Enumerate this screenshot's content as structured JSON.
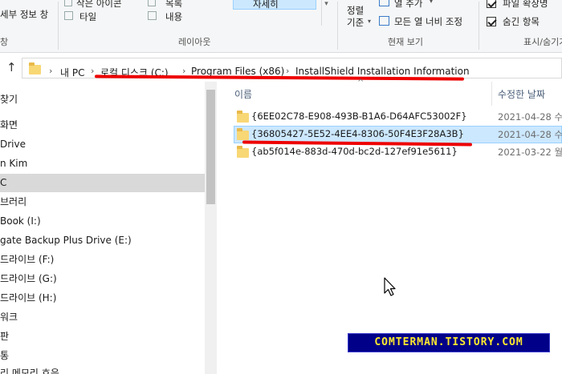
{
  "ribbon": {
    "layout_items": [
      "세부 정보 창",
      "작은 아이콘",
      "목록",
      "자세히",
      "타일",
      "내용"
    ],
    "layout_group": "레이아웃",
    "sort_label": "정렬\n기준",
    "add_column": "열 추가",
    "fit_columns": "모든 열 너비 조정",
    "current_view_group": "현재 보기",
    "file_ext": "파일 확장명",
    "hidden_items": "숨긴 항목",
    "show_hide_group": "표시/숨기기"
  },
  "address": {
    "crumbs": [
      "내 PC",
      "로컬 디스크 (C:)",
      "Program Files (x86)",
      "InstallShield Installation Information"
    ]
  },
  "nav": {
    "items": [
      "찾기",
      "화면",
      "Drive",
      "n Kim",
      "C",
      "브러리",
      "Book (I:)",
      "gate Backup Plus Drive (E:)",
      "드라이브 (F:)",
      "드라이브 (G:)",
      "드라이브 (H:)",
      "워크",
      "판",
      "통",
      "리 메모리 흐음"
    ]
  },
  "content": {
    "col_name": "이름",
    "col_date": "수정한 날짜",
    "rows": [
      {
        "name": "{6EE02C78-E908-493B-B1A6-D64AFC53002F}",
        "date": "2021-04-28 수"
      },
      {
        "name": "{36805427-5E52-4EE4-8306-50F4E3F28A3B}",
        "date": "2021-04-28 수"
      },
      {
        "name": "{ab5f014e-883d-470d-bc2d-127ef91e5611}",
        "date": "2021-03-22 월"
      }
    ]
  },
  "watermark": "COMTERMAN.TISTORY.COM",
  "colors": {
    "highlight_line": "#ee0000",
    "selection": "#cce8ff",
    "folder": "#f8d775",
    "watermark_bg": "#000088",
    "watermark_text": "#ffe92e"
  }
}
